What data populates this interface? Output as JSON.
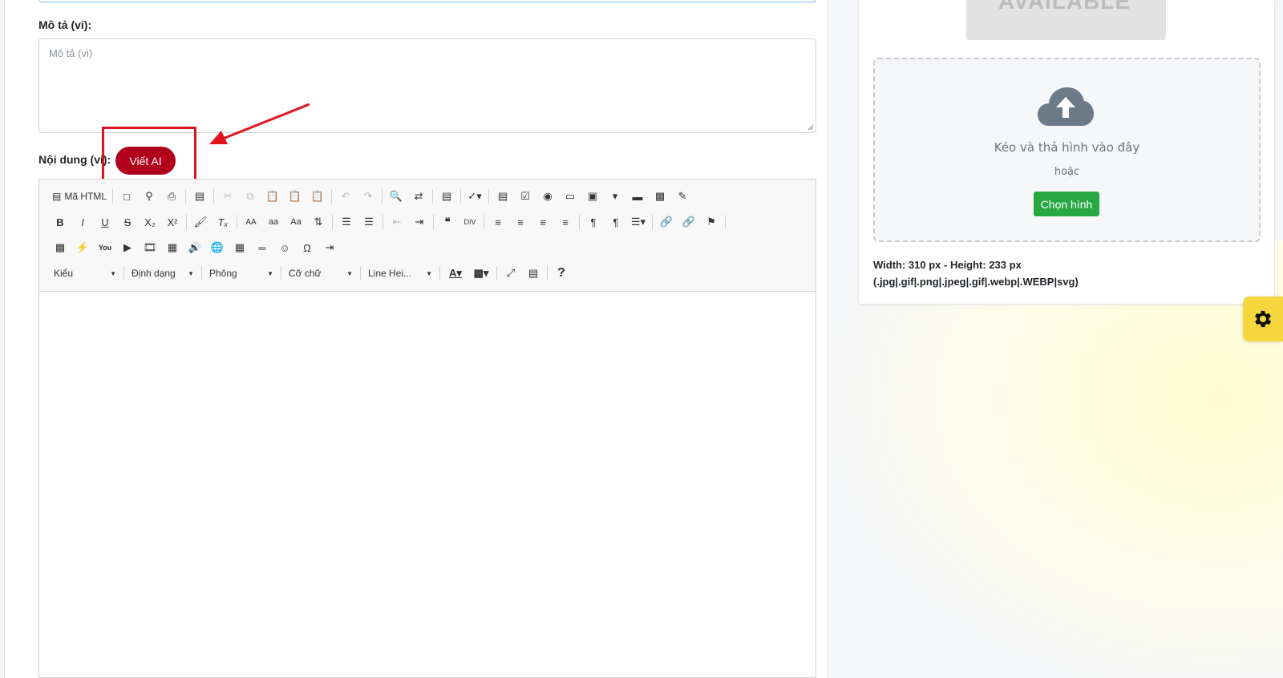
{
  "description_field": {
    "label": "Mô tả (vi):",
    "placeholder": "Mô tả (vi)"
  },
  "content_field": {
    "label": "Nội dung (vi):",
    "ai_button_label": "Viết AI"
  },
  "editor": {
    "source_label": "Mã HTML",
    "combos": {
      "styles": "Kiểu",
      "format": "Định dạng",
      "font": "Phông",
      "size": "Cỡ chữ",
      "line_height": "Line Hei..."
    },
    "help_label": "?"
  },
  "image_upload": {
    "placeholder_image_text": "AVAILABLE",
    "drop_text": "Kéo và thả hình vào đây",
    "or_text": "hoặc",
    "choose_button_label": "Chọn hình",
    "size_text": "Width: 310 px - Height: 233 px",
    "formats_text": "(.jpg|.gif|.png|.jpeg|.gif|.webp|.WEBP|svg)"
  },
  "colors": {
    "ai_button": "#b1001c",
    "highlight": "#e0141e",
    "choose_button": "#28a745",
    "settings_tab": "#f5d63d",
    "cloud_icon": "#6c7a89"
  }
}
